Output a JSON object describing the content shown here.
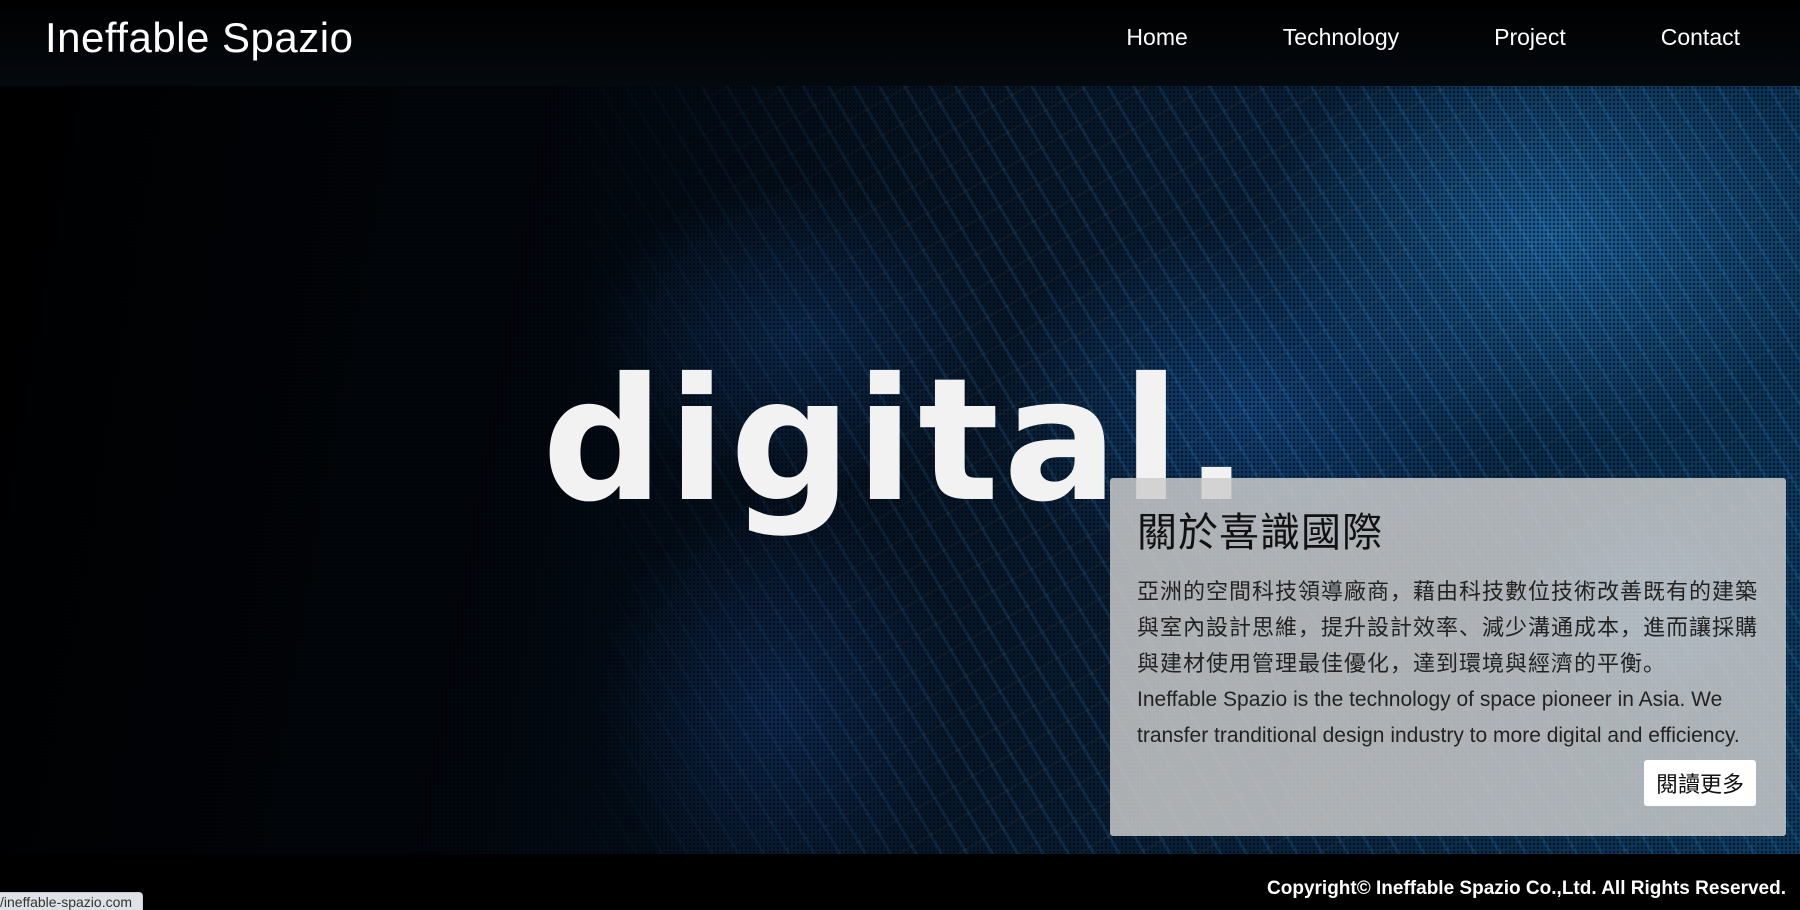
{
  "header": {
    "brand": "Ineffable Spazio",
    "nav": [
      {
        "label": "Home"
      },
      {
        "label": "Technology"
      },
      {
        "label": "Project"
      },
      {
        "label": "Contact"
      }
    ]
  },
  "hero": {
    "word": "digital."
  },
  "about": {
    "title": "關於喜識國際",
    "body_zh": "亞洲的空間科技領導廠商，藉由科技數位技術改善既有的建築與室內設計思維，提升設計效率、減少溝通成本，進而讓採購與建材使用管理最佳優化，達到環境與經濟的平衡。",
    "body_en": "Ineffable Spazio is the technology of space pioneer in Asia. We transfer tranditional design industry to more digital and efficiency.",
    "button": "閱讀更多"
  },
  "footer": {
    "copyright": "Copyright© Ineffable Spazio Co.,Ltd. All Rights Reserved."
  },
  "status_bar": {
    "url": "/ineffable-spazio.com"
  },
  "colors": {
    "background": "#000000",
    "card_background": "#cdcdcd",
    "text_light": "#ffffff",
    "text_dark": "#111111"
  }
}
